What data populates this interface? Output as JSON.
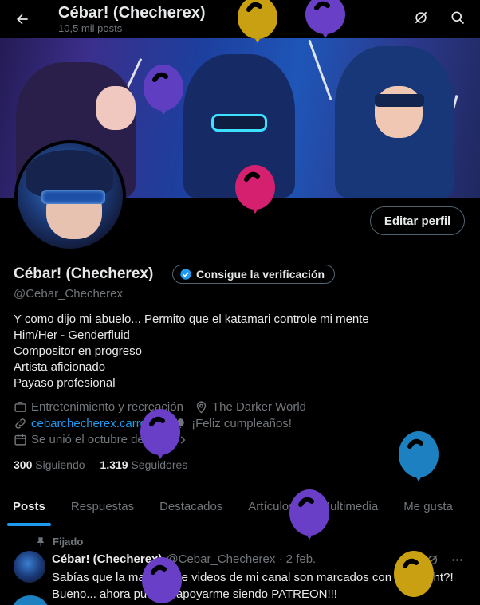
{
  "header": {
    "title": "Cébar! (Checherex)",
    "post_count": "10,5 mil posts",
    "back_icon": "back-arrow-icon",
    "right_icons": [
      "no-grok-icon",
      "search-icon"
    ]
  },
  "profile": {
    "name": "Cébar! (Checherex)",
    "verify_label": "Consigue la verificación",
    "handle": "@Cebar_Checherex",
    "edit_label": "Editar perfil",
    "bio": [
      "Y como dijo mi abuelo... Permito que el katamari controle mi mente",
      "Him/Her - Genderfluid",
      "Compositor en progreso",
      "Artista aficionado",
      "Payaso profesional"
    ],
    "category": "Entretenimiento y recreación",
    "location": "The Darker World",
    "website": "cebarchecherex.carrd.co",
    "birthday": "¡Feliz cumpleaños!",
    "joined": "Se unió el octubre de 2019",
    "following_count": "300",
    "following_label": "Siguiendo",
    "followers_count": "1.319",
    "followers_label": "Seguidores"
  },
  "tabs": [
    "Posts",
    "Respuestas",
    "Destacados",
    "Artículos",
    "Multimedia",
    "Me gusta"
  ],
  "pinned_label": "Fijado",
  "tweet": {
    "name": "Cébar! (Checherex)",
    "meta": "@Cebar_Checherex · 2 feb.",
    "lines": [
      "Sabías que la mayoría de videos de mi canal son marcados con copyright?!",
      "Bueno... ahora puedes apoyarme siendo PATREON!!!"
    ]
  },
  "colors": {
    "accent": "#1d9bf0",
    "text": "#e7e9ea",
    "muted": "#71767b",
    "balloon_yellow": "#c9a012",
    "balloon_purple": "#6a3fc8",
    "balloon_magenta": "#d4206e",
    "balloon_blue": "#1d80c0"
  }
}
